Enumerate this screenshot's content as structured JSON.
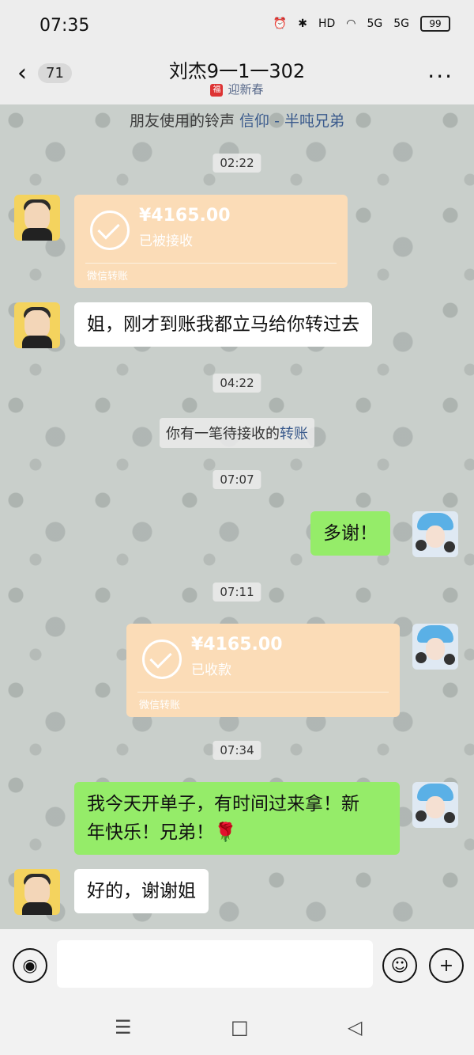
{
  "status_bar": {
    "time": "07:35",
    "icons": [
      "alarm-icon",
      "bluetooth-icon",
      "hd-icon",
      "wifi-icon",
      "5g-signal-icon",
      "5g-signal-icon"
    ],
    "hd_label": "HD",
    "sig1_label": "5G",
    "sig2_label": "5G",
    "battery": "99"
  },
  "header": {
    "back_symbol": "‹",
    "unread_count": "71",
    "title": "刘杰9一1一302",
    "subtitle": "迎新春",
    "more_symbol": "···"
  },
  "chat": {
    "ringtone_prefix": "朋友使用的铃声 ",
    "ringtone_link": "信仰 - 半吨兄弟",
    "timestamps": [
      "02:22",
      "04:22",
      "07:07",
      "07:11",
      "07:34"
    ],
    "transfer_1": {
      "amount": "¥4165.00",
      "state": "已被接收",
      "brand": "微信转账"
    },
    "msg_1": "姐，刚才到账我都立马给你转过去",
    "system_prefix": "你有一笔待接收的",
    "system_link": "转账",
    "msg_2": "多谢！",
    "transfer_2": {
      "amount": "¥4165.00",
      "state": "已收款",
      "brand": "微信转账"
    },
    "msg_3_line1": "我今天开单子，有时间过来拿！新",
    "msg_3_line2": "年快乐！兄弟！🌹",
    "msg_4": "好的，谢谢姐"
  },
  "input_bar": {
    "voice_symbol": "◉",
    "emoji_symbol": "☺",
    "plus_symbol": "+"
  },
  "nav_bar": {
    "menu_symbol": "☰",
    "home_symbol": "□",
    "back_symbol": "◁"
  },
  "colors": {
    "bubble_green": "#95ec69",
    "transfer_bg": "#fbdcb7",
    "link_blue": "#3a5a8c"
  }
}
